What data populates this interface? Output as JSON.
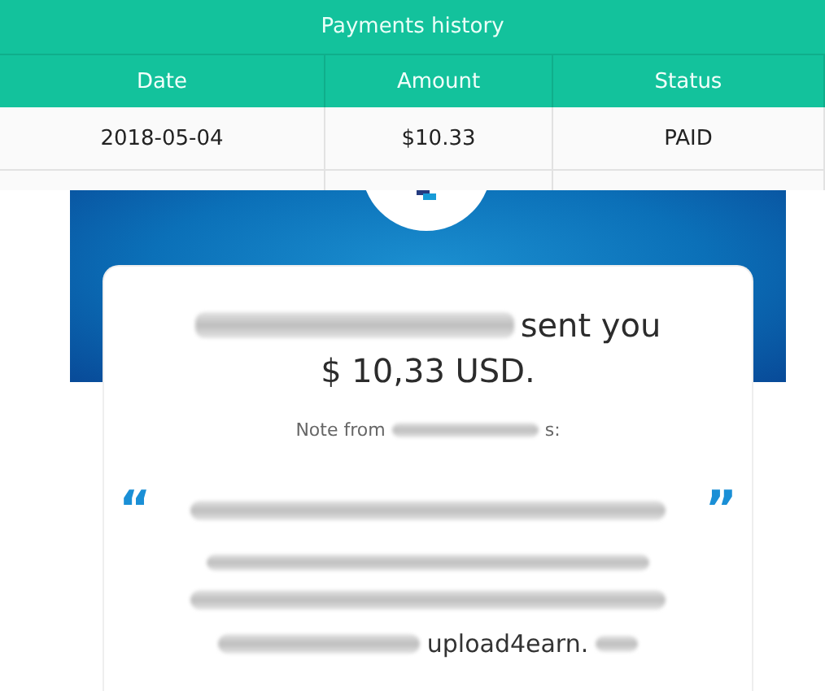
{
  "table": {
    "title": "Payments history",
    "columns": [
      "Date",
      "Amount",
      "Status"
    ],
    "rows": [
      {
        "cells": [
          "2018-05-04",
          "$10.33",
          "PAID"
        ]
      }
    ]
  },
  "email": {
    "headline_suffix": "sent you",
    "amount": "$ 10,33 USD.",
    "note_label": "Note from",
    "note_label_end": "s:",
    "open_quote": "“",
    "close_quote": "”",
    "message_tail": "upload4earn."
  }
}
